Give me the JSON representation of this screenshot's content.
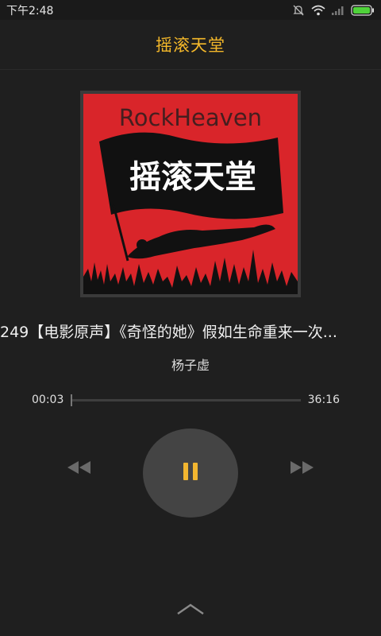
{
  "status_bar": {
    "time": "下午2:48",
    "icons": [
      "silent-icon",
      "wifi-icon",
      "signal-icon",
      "battery-icon"
    ]
  },
  "header": {
    "title": "摇滚天堂"
  },
  "album": {
    "top_text": "RockHeaven",
    "flag_text": "摇滚天堂"
  },
  "track": {
    "title": "249【电影原声】《奇怪的她》假如生命重来一次...",
    "artist": "杨子虚"
  },
  "progress": {
    "elapsed": "00:03",
    "total": "36:16",
    "fraction": 0.0014
  },
  "controls": {
    "prev_icon": "rewind-icon",
    "play_icon": "pause-icon",
    "next_icon": "fast-forward-icon",
    "expand_icon": "chevron-up-icon"
  },
  "colors": {
    "accent": "#f4b82a",
    "background": "#1f1f1f",
    "album_red": "#d9252a"
  }
}
